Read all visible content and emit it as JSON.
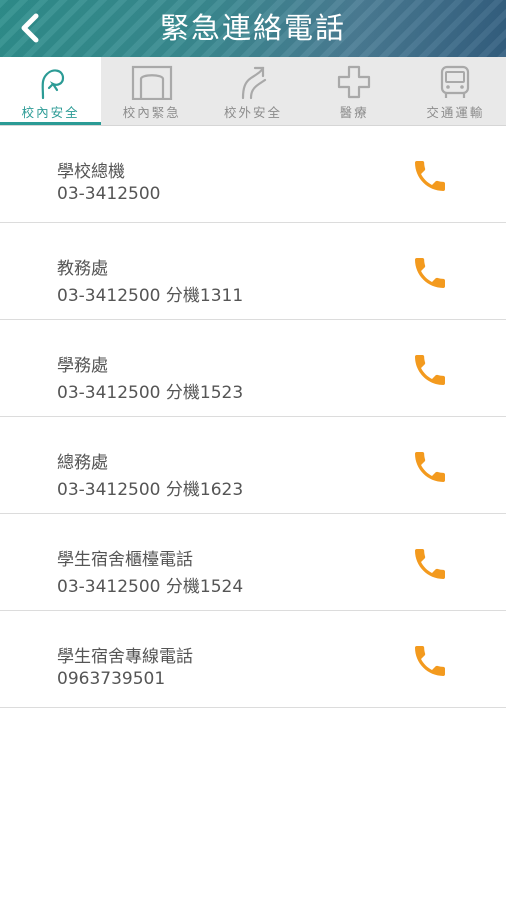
{
  "header": {
    "title": "緊急連絡電話",
    "back_icon": "chevron-left-icon"
  },
  "colors": {
    "accent": "#2b9b95",
    "call_icon": "#f39a1e",
    "header_bg": "#3a8a91"
  },
  "tabs": [
    {
      "label": "校內安全",
      "icon": "campus-safety-icon",
      "active": true
    },
    {
      "label": "校內緊急",
      "icon": "gate-icon",
      "active": false
    },
    {
      "label": "校外安全",
      "icon": "outdoor-safety-icon",
      "active": false
    },
    {
      "label": "醫療",
      "icon": "medical-cross-icon",
      "active": false
    },
    {
      "label": "交通運輸",
      "icon": "bus-icon",
      "active": false
    }
  ],
  "contacts": [
    {
      "name": "學校總機",
      "phone": "03-3412500",
      "icon": "phone-icon"
    },
    {
      "name": "教務處",
      "phone": "03-3412500 分機1311",
      "icon": "phone-icon"
    },
    {
      "name": "學務處",
      "phone": "03-3412500 分機1523",
      "icon": "phone-icon"
    },
    {
      "name": "總務處",
      "phone": "03-3412500 分機1623",
      "icon": "phone-icon"
    },
    {
      "name": "學生宿舍櫃檯電話",
      "phone": "03-3412500 分機1524",
      "icon": "phone-icon"
    },
    {
      "name": "學生宿舍專線電話",
      "phone": "0963739501",
      "icon": "phone-icon"
    }
  ]
}
